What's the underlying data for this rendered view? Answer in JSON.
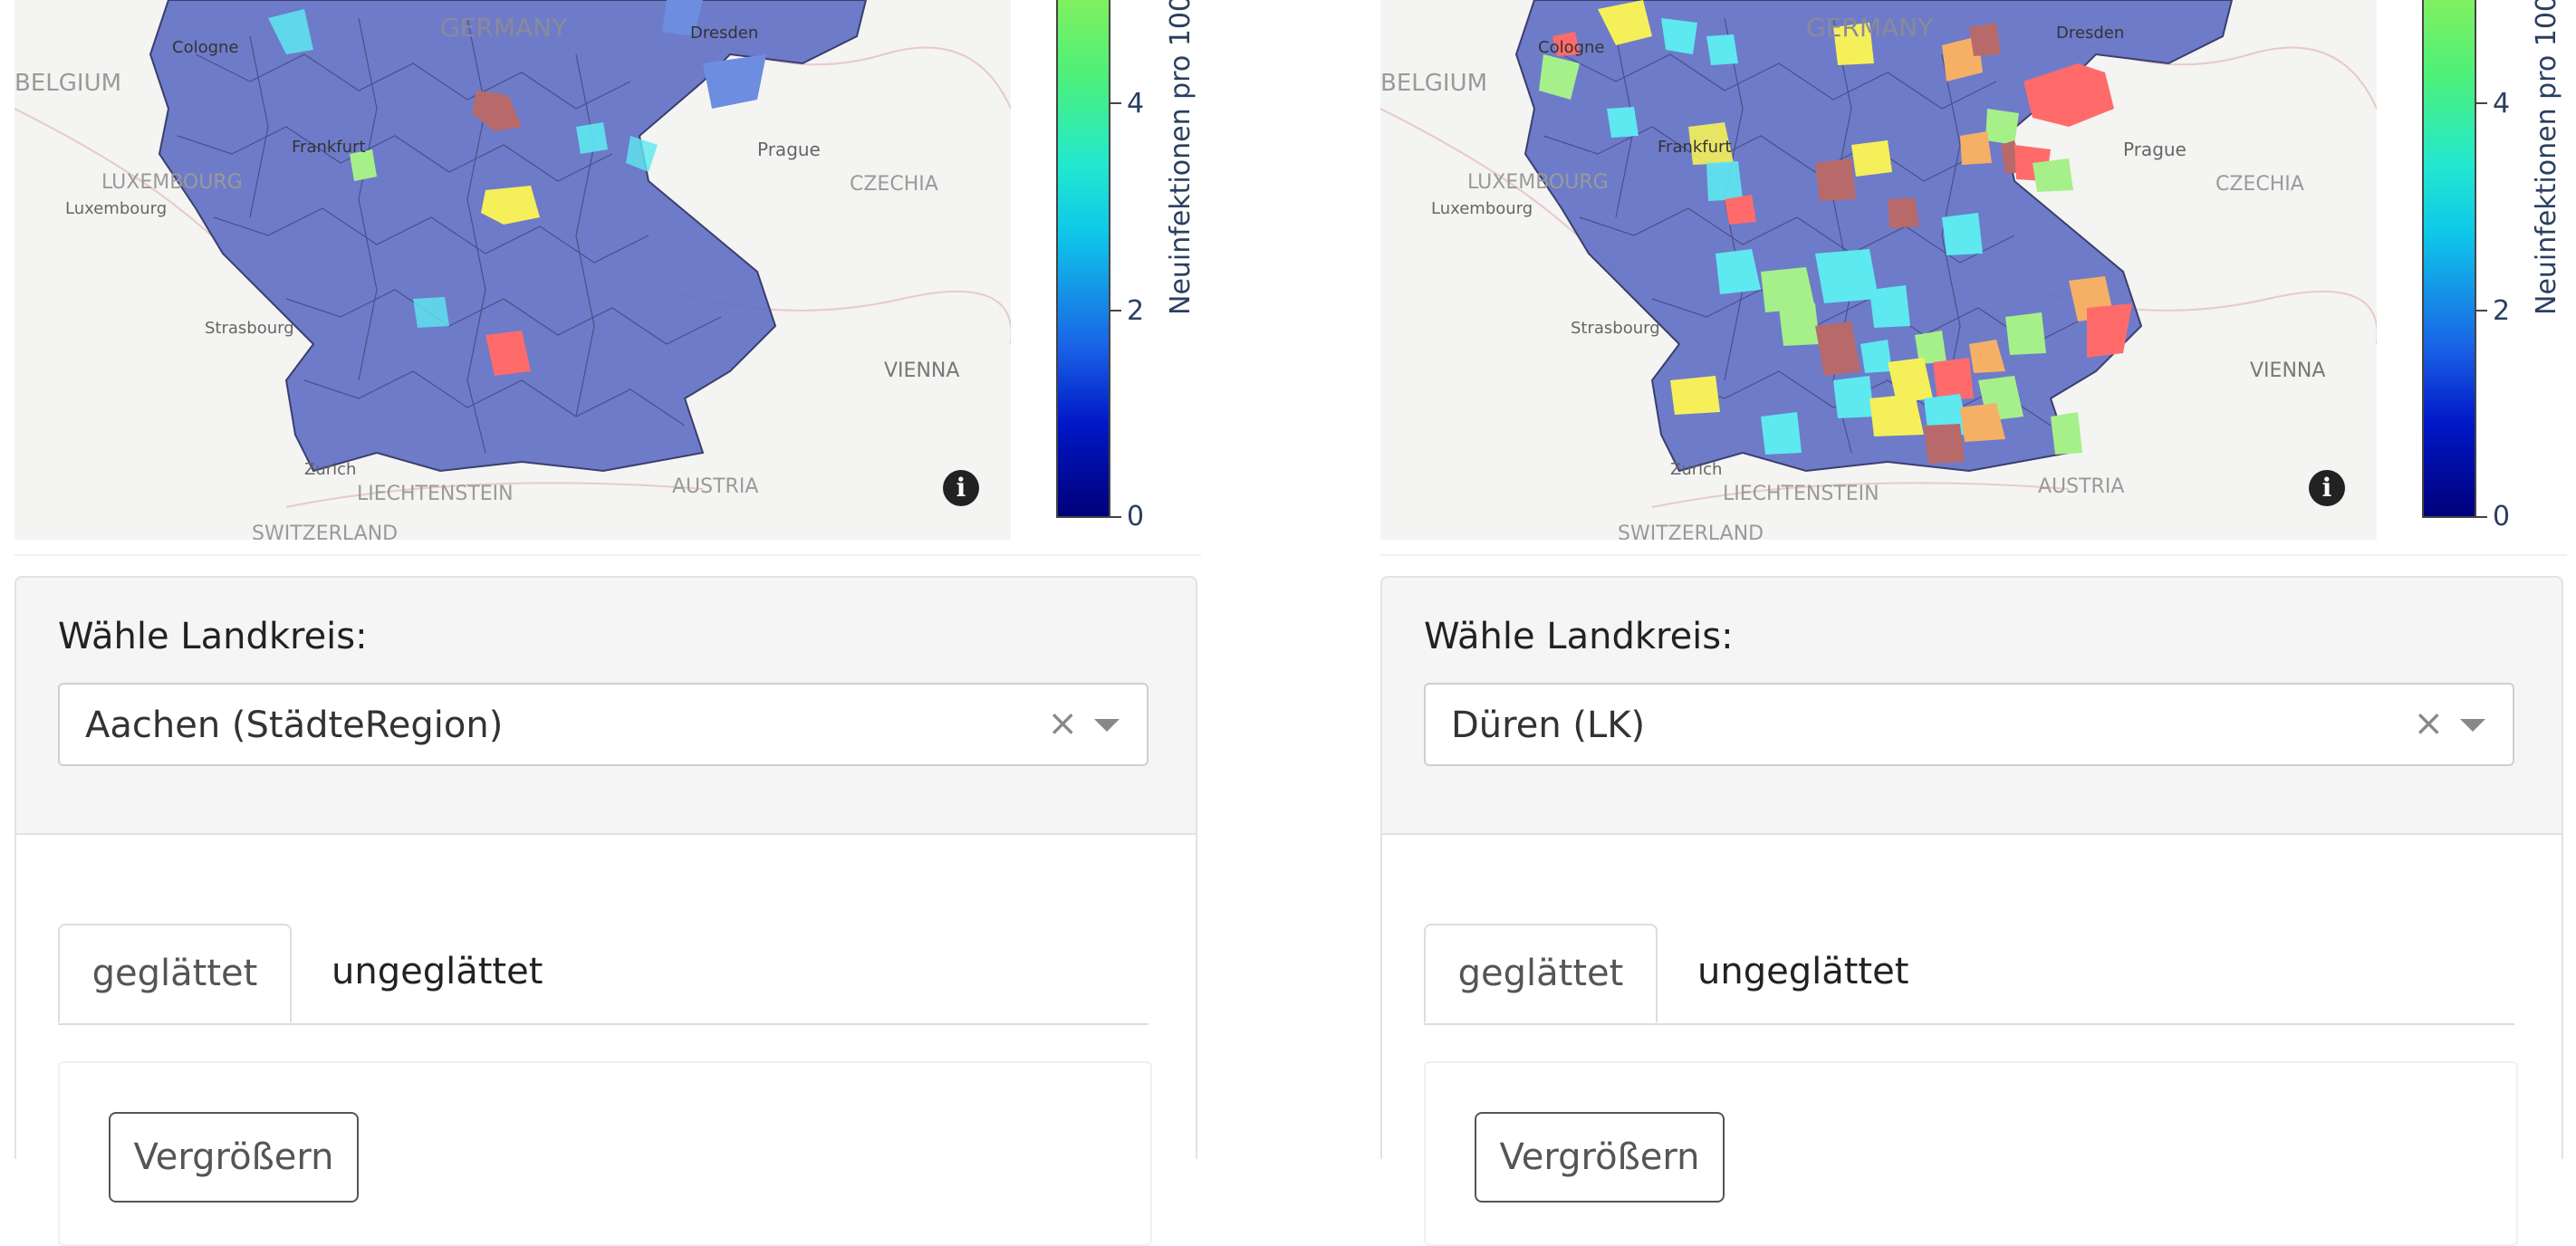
{
  "left": {
    "map_labels": {
      "germany": "GERMANY",
      "belgium": "BELGIUM",
      "luxembourg_country": "LUXEMBOURG",
      "luxembourg_city": "Luxembourg",
      "czechia": "CZECHIA",
      "prague": "Prague",
      "vienna": "VIENNA",
      "austria": "AUSTRIA",
      "liechtenstein": "LIECHTENSTEIN",
      "switzerland": "SWITZERLAND",
      "zurich": "Zurich",
      "strasbourg": "Strasbourg",
      "frankfurt": "Frankfurt",
      "dresden": "Dresden",
      "cologne": "Cologne"
    },
    "colorbar": {
      "title": "Neuinfektionen pro 100.",
      "ticks": [
        "4",
        "2",
        "0"
      ]
    },
    "selector": {
      "label": "Wähle Landkreis:",
      "value": "Aachen (StädteRegion)",
      "clear": "×"
    },
    "tabs": {
      "smoothed": "geglättet",
      "unsmoothed": "ungeglättet"
    },
    "zoom_button": "Vergrößern"
  },
  "right": {
    "map_labels": {
      "germany": "GERMANY",
      "belgium": "BELGIUM",
      "luxembourg_country": "LUXEMBOURG",
      "luxembourg_city": "Luxembourg",
      "czechia": "CZECHIA",
      "prague": "Prague",
      "vienna": "VIENNA",
      "austria": "AUSTRIA",
      "liechtenstein": "LIECHTENSTEIN",
      "switzerland": "SWITZERLAND",
      "zurich": "Zurich",
      "strasbourg": "Strasbourg",
      "frankfurt": "Frankfurt",
      "dresden": "Dresden",
      "cologne": "Cologne"
    },
    "colorbar": {
      "title": "Neuinfektionen pro 100.",
      "ticks": [
        "4",
        "2",
        "0"
      ]
    },
    "selector": {
      "label": "Wähle Landkreis:",
      "value": "Düren (LK)",
      "clear": "×"
    },
    "tabs": {
      "smoothed": "geglättet",
      "unsmoothed": "ungeglättet"
    },
    "zoom_button": "Vergrößern"
  },
  "colors": {
    "region_base": "#5f6ec4",
    "region_light": "#6d8ee0",
    "hot_red": "#ff6b6b",
    "hot_brown": "#b86a6a",
    "yellow": "#f5f05a",
    "cyan": "#5ee8f0",
    "green": "#a6f08a",
    "orange": "#f5b066"
  }
}
